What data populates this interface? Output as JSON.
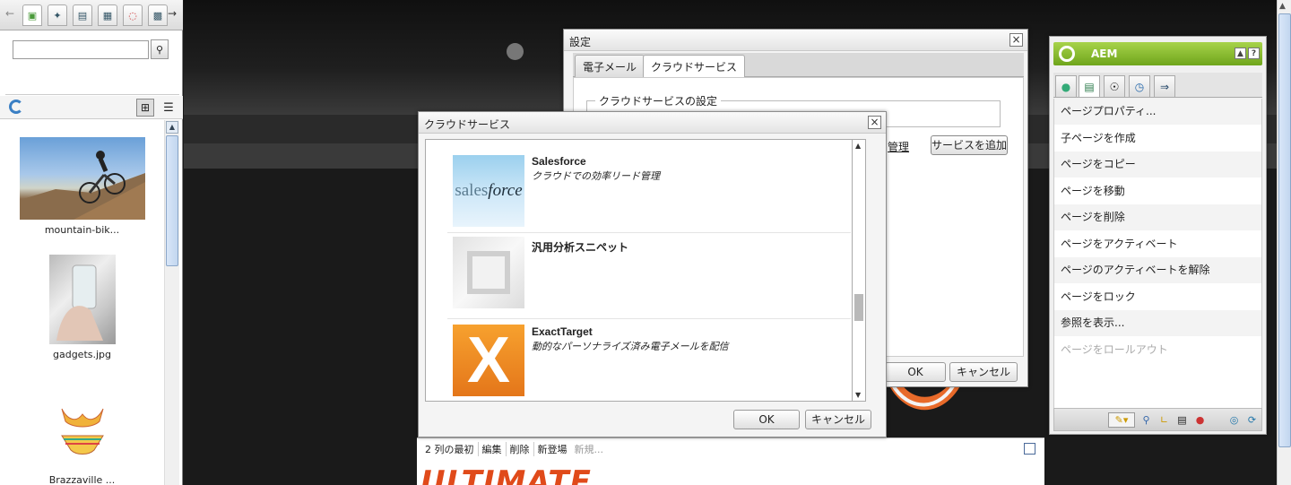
{
  "left_panel": {
    "search": {
      "value": "",
      "placeholder": ""
    },
    "tabs": [
      "images-icon",
      "products-icon",
      "documents-icon",
      "paragraphs-icon",
      "flash-icon",
      "pages-icon"
    ],
    "assets": [
      {
        "caption": "mountain-bik..."
      },
      {
        "caption": "gadgets.jpg"
      },
      {
        "caption": "Brazzaville ..."
      }
    ]
  },
  "settings_dialog": {
    "title": "設定",
    "tabs": [
      "電子メール",
      "クラウドサービス"
    ],
    "active_tab": "クラウドサービス",
    "section_legend": "クラウドサービスの設定",
    "manage_link": "管理",
    "add_service_button": "サービスを追加",
    "ok_button": "OK",
    "cancel_button": "キャンセル"
  },
  "cloud_services_dialog": {
    "title": "クラウドサービス",
    "services": [
      {
        "name": "Salesforce",
        "description": "クラウドでの効率リード管理",
        "logo_text_a": "sales",
        "logo_text_b": "force"
      },
      {
        "name": "汎用分析スニペット",
        "description": ""
      },
      {
        "name": "ExactTarget",
        "description": "動的なパーソナライズ済み電子メールを配信",
        "logo_text": "X"
      }
    ],
    "ok_button": "OK",
    "cancel_button": "キャンセル"
  },
  "editbar": {
    "label": "2 列の最初",
    "items": [
      "編集",
      "削除",
      "新登場"
    ],
    "disabled_item": "新規..."
  },
  "page_banner": {
    "text": "ULTIMATE"
  },
  "sidekick": {
    "title": "AEM",
    "menu": [
      {
        "label": "ページプロパティ..."
      },
      {
        "label": "子ページを作成"
      },
      {
        "label": "ページをコピー"
      },
      {
        "label": "ページを移動"
      },
      {
        "label": "ページを削除"
      },
      {
        "label": "ページをアクティベート"
      },
      {
        "label": "ページのアクティベートを解除"
      },
      {
        "label": "ページをロック"
      },
      {
        "label": "参照を表示..."
      },
      {
        "label": "ページをロールアウト",
        "disabled": true
      }
    ],
    "colors": {
      "header_top": "#a7d34a",
      "header_bottom": "#6fa51c"
    }
  }
}
